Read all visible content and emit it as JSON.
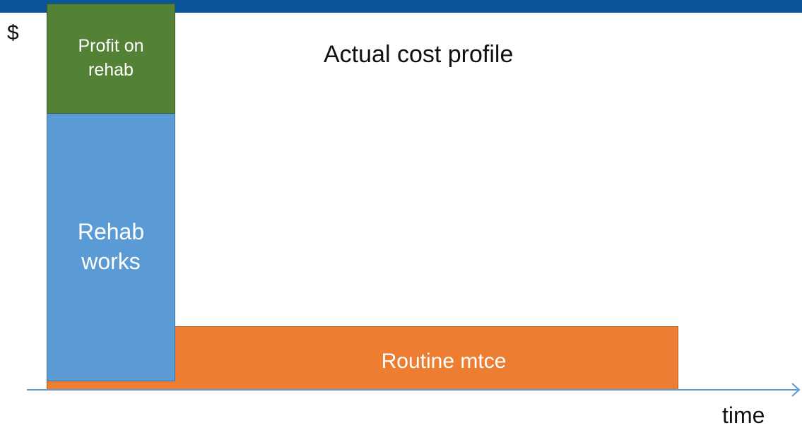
{
  "y_axis_symbol": "$",
  "title": "Actual cost profile",
  "x_axis_label": "time",
  "blocks": {
    "profit": "Profit on\nrehab",
    "rehab": "Rehab\nworks",
    "routine": "Routine mtce"
  },
  "colors": {
    "header": "#0a559a",
    "profit": "#538135",
    "rehab": "#5b9bd5",
    "routine": "#ed7d31",
    "axis": "#5b9bd5"
  }
}
